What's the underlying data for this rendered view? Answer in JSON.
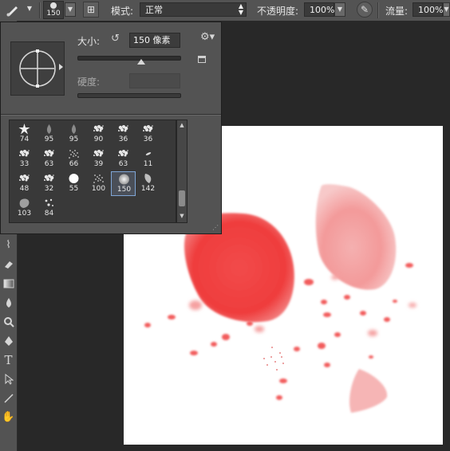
{
  "options_bar": {
    "brush_size_value": "150",
    "mode_label": "模式:",
    "mode_value": "正常",
    "opacity_label": "不透明度:",
    "opacity_value": "100%",
    "flow_label": "流量:",
    "flow_value": "100%"
  },
  "brush_panel": {
    "size_label": "大小:",
    "size_value": "150 像素",
    "size_fraction": 0.38,
    "hardness_label": "硬度:",
    "hardness_value": "",
    "presets": [
      {
        "num": "74",
        "shape": "star"
      },
      {
        "num": "95",
        "shape": "drop"
      },
      {
        "num": "95",
        "shape": "drop"
      },
      {
        "num": "90",
        "shape": "splatter"
      },
      {
        "num": "36",
        "shape": "splatter"
      },
      {
        "num": "36",
        "shape": "splatter"
      },
      {
        "num": "33",
        "shape": "splatter"
      },
      {
        "num": "63",
        "shape": "splatter"
      },
      {
        "num": "66",
        "shape": "noise"
      },
      {
        "num": "39",
        "shape": "splatter"
      },
      {
        "num": "63",
        "shape": "splatter"
      },
      {
        "num": "11",
        "shape": "dash"
      },
      {
        "num": "48",
        "shape": "splatter"
      },
      {
        "num": "32",
        "shape": "splatter"
      },
      {
        "num": "55",
        "shape": "round-hard"
      },
      {
        "num": "100",
        "shape": "noise"
      },
      {
        "num": "150",
        "shape": "round-soft"
      },
      {
        "num": "142",
        "shape": "leaf"
      },
      {
        "num": "103",
        "shape": "blob"
      },
      {
        "num": "84",
        "shape": "dots"
      }
    ],
    "selected_index": 16
  },
  "tools": [
    "patch-tool",
    "eraser-tool",
    "gradient-tool",
    "blur-tool",
    "dodge-tool",
    "pen-tool",
    "type-tool",
    "path-select-tool",
    "line-tool",
    "hand-tool"
  ]
}
